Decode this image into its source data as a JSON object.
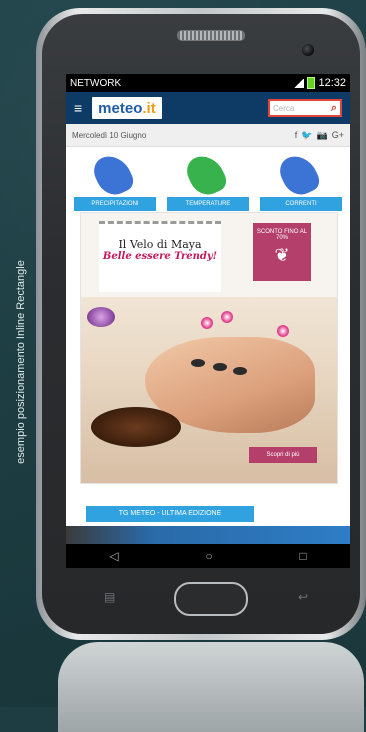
{
  "caption": "esempio posizionamento Inline Rectangle",
  "status_bar": {
    "carrier": "NETWORK",
    "time": "12:32"
  },
  "header": {
    "logo_text": "meteo",
    "logo_suffix": ".it",
    "menu_icon": "hamburger-icon",
    "search_placeholder": "Cerca",
    "search_icon": "search-icon"
  },
  "date_bar": {
    "text": "Mercoledì 10 Giugno",
    "icons": [
      "f",
      "🐦",
      "📷",
      "G+"
    ]
  },
  "maps": [
    {
      "label": "PRECIPITAZIONI",
      "color": "#3c74d6"
    },
    {
      "label": "TEMPERATURE",
      "color": "#37b24d"
    },
    {
      "label": "CORRENTI",
      "color": "#3c74d6"
    }
  ],
  "ad": {
    "title": "Il Velo di Maya",
    "tagline": "Belle essere Trendy!",
    "badge_text": "SCONTO FINO AL 70%",
    "cta": "Scopri di più"
  },
  "news_button": "TG METEO - ULTIMA EDIZIONE",
  "nav": [
    "◁",
    "○",
    "□"
  ]
}
